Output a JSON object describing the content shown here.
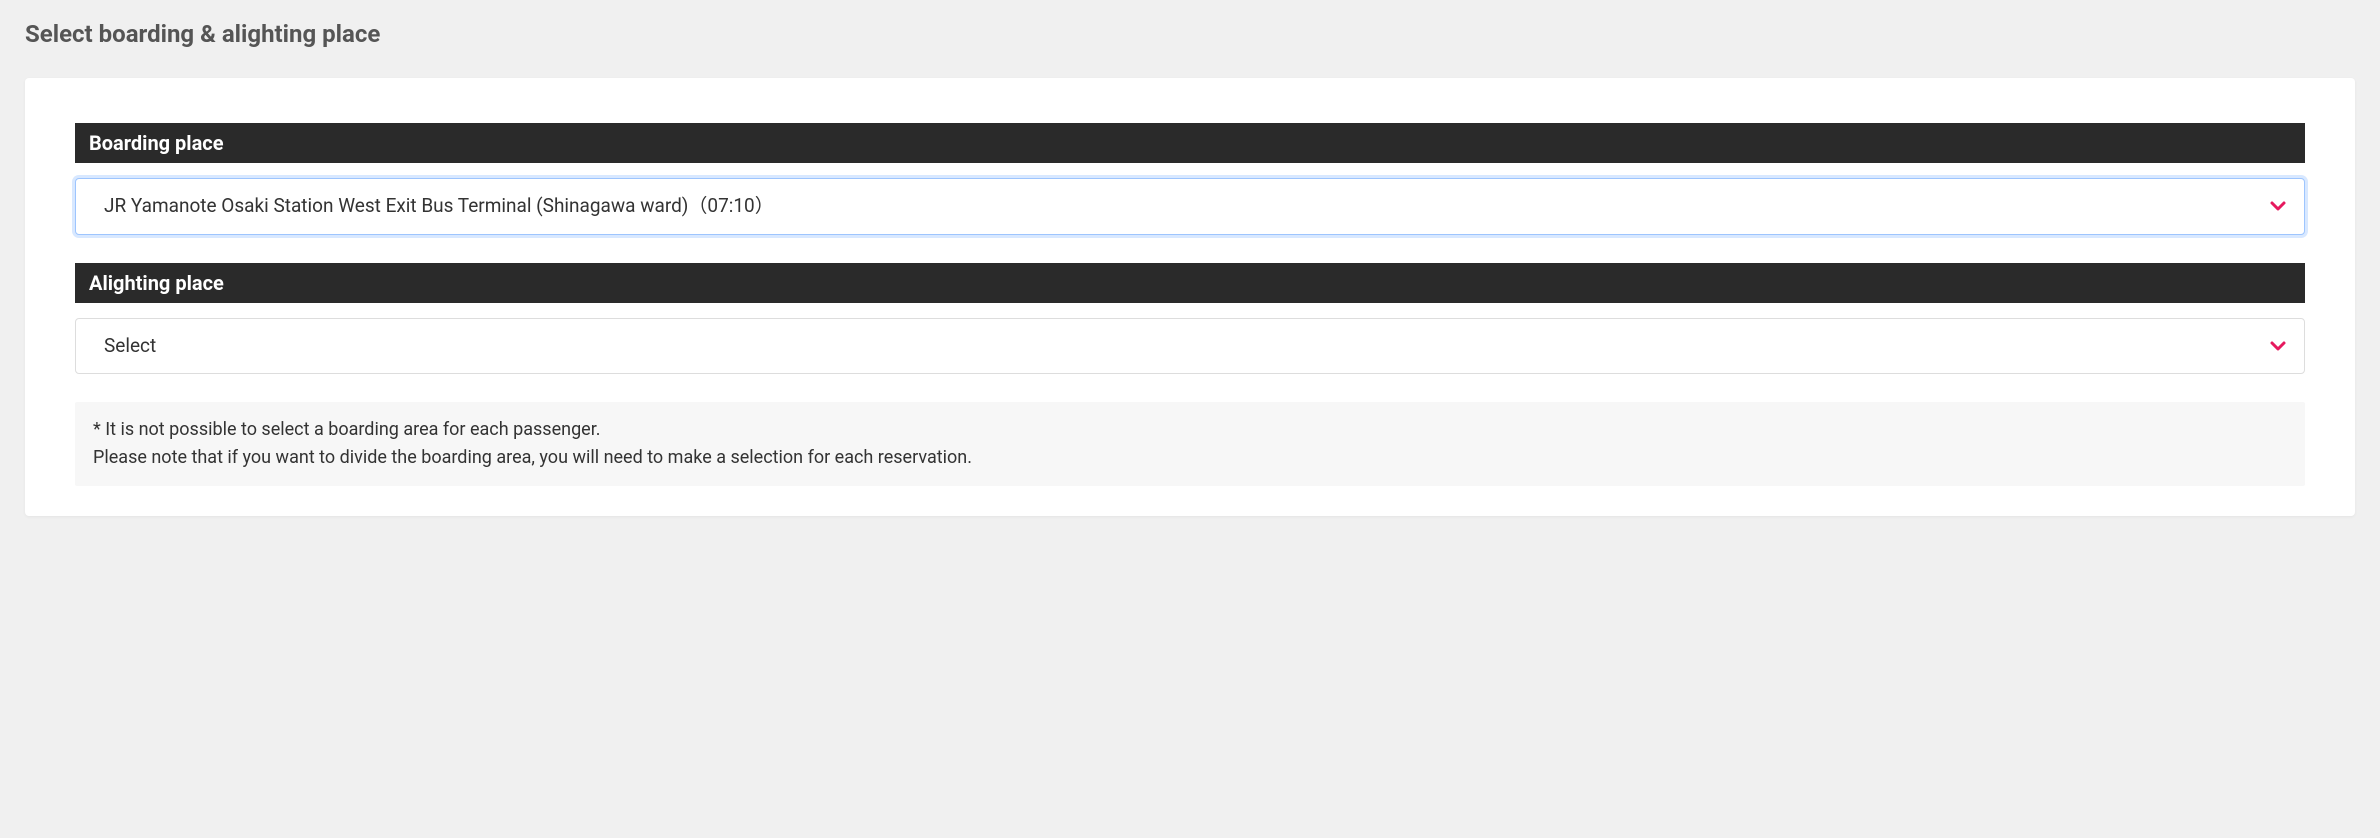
{
  "page": {
    "title": "Select boarding & alighting place"
  },
  "sections": {
    "boarding": {
      "label": "Boarding place",
      "selected": "JR Yamanote Osaki Station West Exit Bus Terminal (Shinagawa ward)（07:10）"
    },
    "alighting": {
      "label": "Alighting place",
      "selected": "Select"
    }
  },
  "note": {
    "line1": "* It is not possible to select a boarding area for each passenger.",
    "line2": "Please note that if you want to divide the boarding area, you will need to make a selection for each reservation."
  },
  "colors": {
    "accent": "#e6195e"
  }
}
